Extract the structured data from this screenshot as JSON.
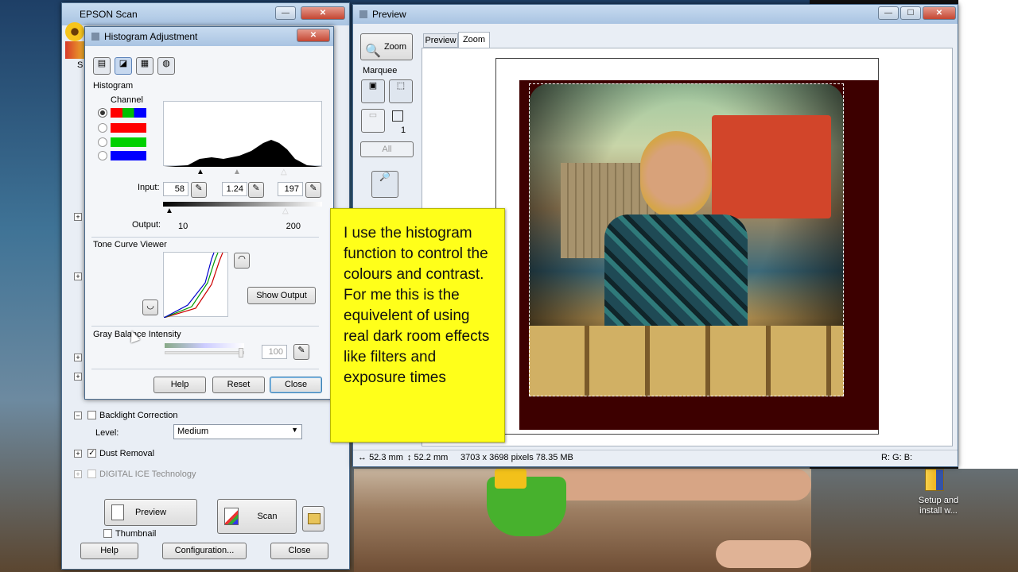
{
  "epson": {
    "title": "EPSON Scan",
    "s_label": "S",
    "backlight_label": "Backlight Correction",
    "level_label": "Level:",
    "level_value": "Medium",
    "dust_label": "Dust Removal",
    "ice_label": "DIGITAL ICE Technology",
    "preview_btn": "Preview",
    "scan_btn": "Scan",
    "thumbnail_label": "Thumbnail",
    "help_btn": "Help",
    "config_btn": "Configuration...",
    "close_btn": "Close"
  },
  "histogram": {
    "title": "Histogram Adjustment",
    "histogram_section": "Histogram",
    "channel_label": "Channel",
    "channels": [
      "#ff0000",
      "#00c000",
      "#0000ff"
    ],
    "input_label": "Input:",
    "input_shadow": "58",
    "input_gamma": "1.24",
    "input_highlight": "197",
    "output_label": "Output:",
    "output_low": "10",
    "output_high": "200",
    "tone_curve_label": "Tone Curve Viewer",
    "show_output_btn": "Show Output",
    "gray_balance_label": "Gray Balance Intensity",
    "gray_balance_value": "100",
    "help_btn": "Help",
    "reset_btn": "Reset",
    "close_btn": "Close"
  },
  "preview": {
    "title": "Preview",
    "zoom_btn": "Zoom",
    "marquee_label": "Marquee",
    "marquee_count": "1",
    "all_btn": "All",
    "tabs": [
      "Preview",
      "Zoom"
    ],
    "active_tab": "Zoom",
    "width_mm": "52.3 mm",
    "height_mm": "52.2 mm",
    "pixel_info": "3703 x 3698 pixels 78.35 MB",
    "rgb_readout": "R: G: B:"
  },
  "callout": {
    "text": "I use the histogram function to control the colours and contrast. For me this is the equivelent of using real dark room effects like filters and exposure times"
  },
  "desktop": {
    "icon_label": "Setup and install w..."
  }
}
